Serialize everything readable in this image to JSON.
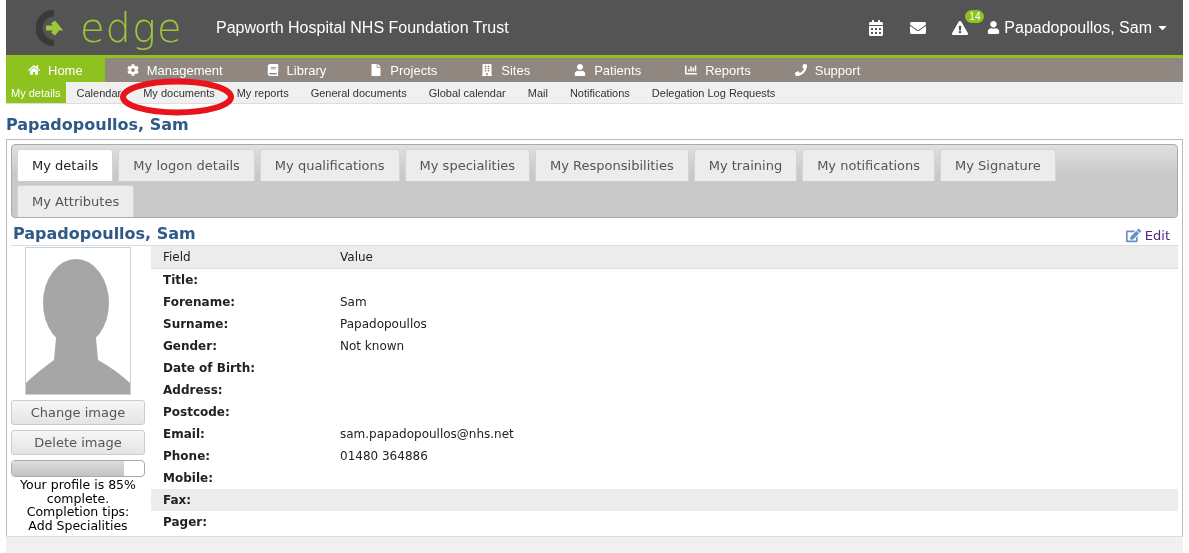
{
  "header": {
    "logo": "edge",
    "organisation": "Papworth Hospital NHS Foundation Trust",
    "alert_badge": "14",
    "user": "Papadopoullos, Sam"
  },
  "main_nav": [
    {
      "label": "Home",
      "selected": true
    },
    {
      "label": "Management",
      "selected": false
    },
    {
      "label": "Library",
      "selected": false
    },
    {
      "label": "Projects",
      "selected": false
    },
    {
      "label": "Sites",
      "selected": false
    },
    {
      "label": "Patients",
      "selected": false
    },
    {
      "label": "Reports",
      "selected": false
    },
    {
      "label": "Support",
      "selected": false
    }
  ],
  "sub_nav": [
    {
      "label": "My details",
      "selected": true
    },
    {
      "label": "Calendar",
      "selected": false
    },
    {
      "label": "My documents",
      "selected": false,
      "circled": true
    },
    {
      "label": "My reports",
      "selected": false
    },
    {
      "label": "General documents",
      "selected": false
    },
    {
      "label": "Global calendar",
      "selected": false
    },
    {
      "label": "Mail",
      "selected": false
    },
    {
      "label": "Notifications",
      "selected": false
    },
    {
      "label": "Delegation Log Requests",
      "selected": false
    }
  ],
  "page_title": "Papadopoullos, Sam",
  "tabs": [
    {
      "label": "My details",
      "selected": true
    },
    {
      "label": "My logon details",
      "selected": false
    },
    {
      "label": "My qualifications",
      "selected": false
    },
    {
      "label": "My specialities",
      "selected": false
    },
    {
      "label": "My Responsibilities",
      "selected": false
    },
    {
      "label": "My training",
      "selected": false
    },
    {
      "label": "My notifications",
      "selected": false
    },
    {
      "label": "My Signature",
      "selected": false
    },
    {
      "label": "My Attributes",
      "selected": false
    }
  ],
  "profile": {
    "name": "Papadopoullos, Sam",
    "edit": "Edit",
    "buttons": [
      "Change image",
      "Delete image"
    ],
    "completion": {
      "level": 0.85,
      "text": "Your profile is 85% complete.",
      "tips_title": "Completion tips:",
      "tip": "Add Specialities"
    }
  },
  "table": {
    "columns": [
      "Field",
      "Value"
    ],
    "rows": [
      {
        "field": "Title:",
        "highlighted": false
      },
      {
        "field": "Forename:",
        "value": "Sam",
        "highlighted": false
      },
      {
        "field": "Surname:",
        "value": "Papadopoullos",
        "highlighted": false
      },
      {
        "field": "Gender:",
        "value": "Not known",
        "highlighted": false
      },
      {
        "field": "Date of Birth:",
        "highlighted": false
      },
      {
        "field": "Address:",
        "highlighted": false
      },
      {
        "field": "Postcode:",
        "highlighted": false
      },
      {
        "field": "Email:",
        "value": "sam.papadopoullos@nhs.net",
        "highlighted": false
      },
      {
        "field": "Phone:",
        "value": "01480 364886",
        "highlighted": false
      },
      {
        "field": "Mobile:",
        "highlighted": false
      },
      {
        "field": "Fax:",
        "highlighted": true
      },
      {
        "field": "Pager:",
        "highlighted": false
      }
    ]
  }
}
